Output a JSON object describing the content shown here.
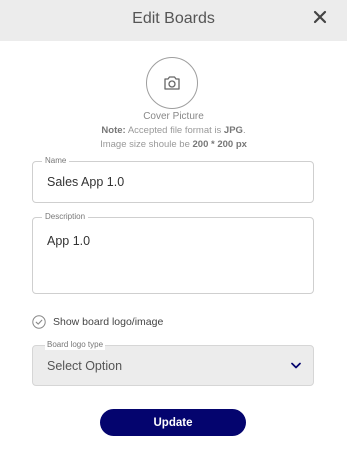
{
  "header": {
    "title": "Edit Boards"
  },
  "cover": {
    "label": "Cover Picture",
    "note_prefix": "Note:",
    "note_text": " Accepted file format is ",
    "note_format": "JPG",
    "note_end": ".",
    "size_text": "Image size shoule be ",
    "size_value": "200 * 200 px"
  },
  "name_field": {
    "label": "Name",
    "value": "Sales App 1.0"
  },
  "description_field": {
    "label": "Description",
    "value": "App 1.0"
  },
  "show_logo": {
    "label": "Show board logo/image"
  },
  "logo_type": {
    "label": "Board logo type",
    "value": "Select Option"
  },
  "update_label": "Update",
  "colors": {
    "primary": "#04046e",
    "header_bg": "#ececec"
  },
  "icons": [
    "close-icon",
    "camera-icon",
    "check-circle-icon",
    "chevron-down-icon"
  ]
}
